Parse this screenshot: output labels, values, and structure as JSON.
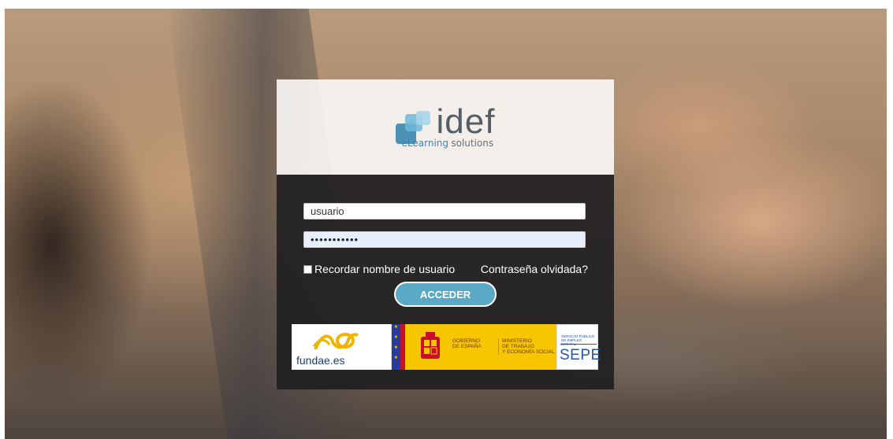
{
  "brand": {
    "name": "idef",
    "tagline_a": "eLearning",
    "tagline_b": "solutions"
  },
  "login": {
    "username_value": "usuario",
    "password_value": "•••••••••••",
    "remember_label": "Recordar nombre de usuario",
    "forgot_label": "Contraseña olvidada?",
    "submit_label": "ACCEDER"
  },
  "partners": {
    "fundae": "fundae.es",
    "gobierno": [
      "GOBIERNO",
      "DE ESPAÑA"
    ],
    "ministerio": [
      "MINISTERIO",
      "DE TRABAJO",
      "Y ECONOMÍA SOCIAL"
    ],
    "sepe_small": [
      "SERVICIO PÚBLICO",
      "DE EMPLEO ESTATAL"
    ],
    "sepe": "SEPE"
  },
  "colors": {
    "accent": "#5aaac6",
    "panel_dark": "#1e1e20",
    "logo_blue": "#3a86b3"
  }
}
